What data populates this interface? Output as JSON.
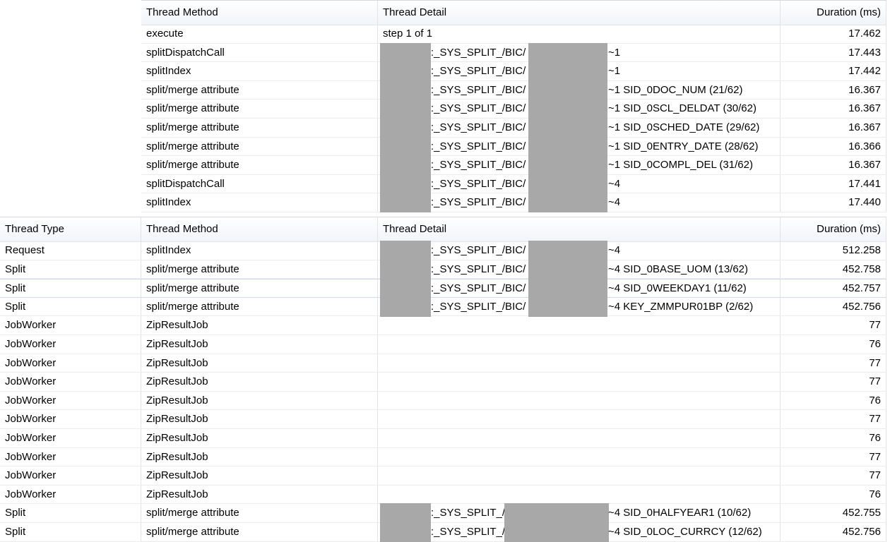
{
  "top_table": {
    "columns": [
      "Thread Method",
      "Thread Detail",
      "Duration (ms)"
    ],
    "rows": [
      {
        "method": "execute",
        "detail_plain": "step 1 of 1",
        "duration": "17.462"
      },
      {
        "method": "splitDispatchCall",
        "mid": ":_SYS_SPLIT_/BIC/",
        "suffix": "~1",
        "duration": "17.443"
      },
      {
        "method": "splitIndex",
        "mid": ":_SYS_SPLIT_/BIC/",
        "suffix": "~1",
        "duration": "17.442"
      },
      {
        "method": "split/merge attribute",
        "mid": ":_SYS_SPLIT_/BIC/",
        "suffix": "~1 SID_0DOC_NUM (21/62)",
        "duration": "16.367"
      },
      {
        "method": "split/merge attribute",
        "mid": ":_SYS_SPLIT_/BIC/",
        "suffix": "~1 SID_0SCL_DELDAT (30/62)",
        "duration": "16.367"
      },
      {
        "method": "split/merge attribute",
        "mid": ":_SYS_SPLIT_/BIC/",
        "suffix": "~1 SID_0SCHED_DATE (29/62)",
        "duration": "16.367"
      },
      {
        "method": "split/merge attribute",
        "mid": ":_SYS_SPLIT_/BIC/",
        "suffix": "~1 SID_0ENTRY_DATE (28/62)",
        "duration": "16.366"
      },
      {
        "method": "split/merge attribute",
        "mid": ":_SYS_SPLIT_/BIC/",
        "suffix": "~1 SID_0COMPL_DEL (31/62)",
        "duration": "16.367"
      },
      {
        "method": "splitDispatchCall",
        "mid": ":_SYS_SPLIT_/BIC/",
        "suffix": "~4",
        "duration": "17.441"
      },
      {
        "method": "splitIndex",
        "mid": ":_SYS_SPLIT_/BIC/",
        "suffix": "~4",
        "duration": "17.440"
      }
    ]
  },
  "bottom_table": {
    "columns": [
      "Thread Type",
      "Thread Method",
      "Thread Detail",
      "Duration (ms)"
    ],
    "selected_row": 2,
    "rows": [
      {
        "type": "Request",
        "method": "splitIndex",
        "mid": ":_SYS_SPLIT_/BIC/",
        "suffix": "~4",
        "duration": "512.258"
      },
      {
        "type": "Split",
        "method": "split/merge attribute",
        "mid": ":_SYS_SPLIT_/BIC/",
        "suffix": "~4 SID_0BASE_UOM (13/62)",
        "duration": "452.758"
      },
      {
        "type": "Split",
        "method": "split/merge attribute",
        "mid": ":_SYS_SPLIT_/BIC/",
        "suffix": "~4 SID_0WEEKDAY1 (11/62)",
        "duration": "452.757"
      },
      {
        "type": "Split",
        "method": "split/merge attribute",
        "mid": ":_SYS_SPLIT_/BIC/",
        "suffix": "~4 KEY_ZMMPUR01BP (2/62)",
        "duration": "452.756"
      },
      {
        "type": "JobWorker",
        "method": "ZipResultJob",
        "duration": "77"
      },
      {
        "type": "JobWorker",
        "method": "ZipResultJob",
        "duration": "76"
      },
      {
        "type": "JobWorker",
        "method": "ZipResultJob",
        "duration": "77"
      },
      {
        "type": "JobWorker",
        "method": "ZipResultJob",
        "duration": "77"
      },
      {
        "type": "JobWorker",
        "method": "ZipResultJob",
        "duration": "76"
      },
      {
        "type": "JobWorker",
        "method": "ZipResultJob",
        "duration": "77"
      },
      {
        "type": "JobWorker",
        "method": "ZipResultJob",
        "duration": "76"
      },
      {
        "type": "JobWorker",
        "method": "ZipResultJob",
        "duration": "77"
      },
      {
        "type": "JobWorker",
        "method": "ZipResultJob",
        "duration": "77"
      },
      {
        "type": "JobWorker",
        "method": "ZipResultJob",
        "duration": "76"
      },
      {
        "type": "Split",
        "method": "split/merge attribute",
        "mid": ":_SYS_SPLIT_/",
        "suffix": "~4 SID_0HALFYEAR1 (10/62)",
        "duration": "452.755",
        "short": true
      },
      {
        "type": "Split",
        "method": "split/merge attribute",
        "mid": ":_SYS_SPLIT_/",
        "suffix": "~4 SID_0LOC_CURRCY (12/62)",
        "duration": "452.756",
        "short": true
      }
    ]
  }
}
